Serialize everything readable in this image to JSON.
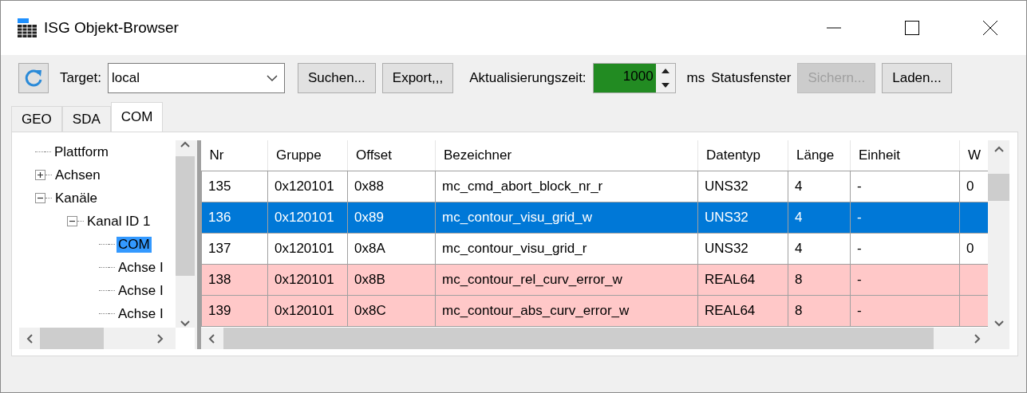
{
  "window": {
    "title": "ISG Objekt-Browser"
  },
  "toolbar": {
    "target_label": "Target:",
    "target_value": "local",
    "buttons": [
      {
        "label": "Suchen...",
        "disabled": false
      },
      {
        "label": "Export,,,",
        "disabled": false
      }
    ],
    "interval_label": "Aktualisierungszeit:",
    "interval_value": "1000",
    "unit": "ms",
    "status_label": "Statusfenster",
    "status_buttons": [
      {
        "label": "Sichern...",
        "disabled": true
      },
      {
        "label": "Laden...",
        "disabled": false
      }
    ]
  },
  "tabs": [
    {
      "label": "GEO",
      "selected": false
    },
    {
      "label": "SDA",
      "selected": false
    },
    {
      "label": "COM",
      "selected": true
    }
  ],
  "tree": [
    {
      "label": "Plattform",
      "selected": false
    },
    {
      "label": "Achsen",
      "selected": false,
      "expanded": false
    },
    {
      "label": "Kanäle",
      "selected": false,
      "expanded": true,
      "children": [
        {
          "label": "Kanal ID 1",
          "selected": false,
          "expanded": true,
          "children": [
            {
              "label": "COM",
              "selected": true
            },
            {
              "label": "Achse I",
              "selected": false
            },
            {
              "label": "Achse I",
              "selected": false
            },
            {
              "label": "Achse I",
              "selected": false
            }
          ]
        }
      ]
    }
  ],
  "table": {
    "columns": [
      "Nr",
      "Gruppe",
      "Offset",
      "Bezeichner",
      "Datentyp",
      "Länge",
      "Einheit",
      "W"
    ],
    "rows": [
      {
        "selected": false,
        "highlighted": false,
        "cells": [
          "135",
          "0x120101",
          "0x88",
          "mc_cmd_abort_block_nr_r",
          "UNS32",
          "4",
          "-",
          "0"
        ]
      },
      {
        "selected": true,
        "cells": [
          "136",
          "0x120101",
          "0x89",
          "mc_contour_visu_grid_w",
          "UNS32",
          "4",
          "-"
        ]
      },
      {
        "selected": false,
        "highlighted": false,
        "cells": [
          "137",
          "0x120101",
          "0x8A",
          "mc_contour_visu_grid_r",
          "UNS32",
          "4",
          "-",
          "0"
        ]
      },
      {
        "selected": false,
        "highlighted": true,
        "cells": [
          "138",
          "0x120101",
          "0x8B",
          "mc_contour_rel_curv_error_w",
          "REAL64",
          "8",
          "-"
        ]
      },
      {
        "selected": false,
        "highlighted": true,
        "cells": [
          "139",
          "0x120101",
          "0x8C",
          "mc_contour_abs_curv_error_w",
          "REAL64",
          "8",
          "-"
        ]
      }
    ]
  }
}
